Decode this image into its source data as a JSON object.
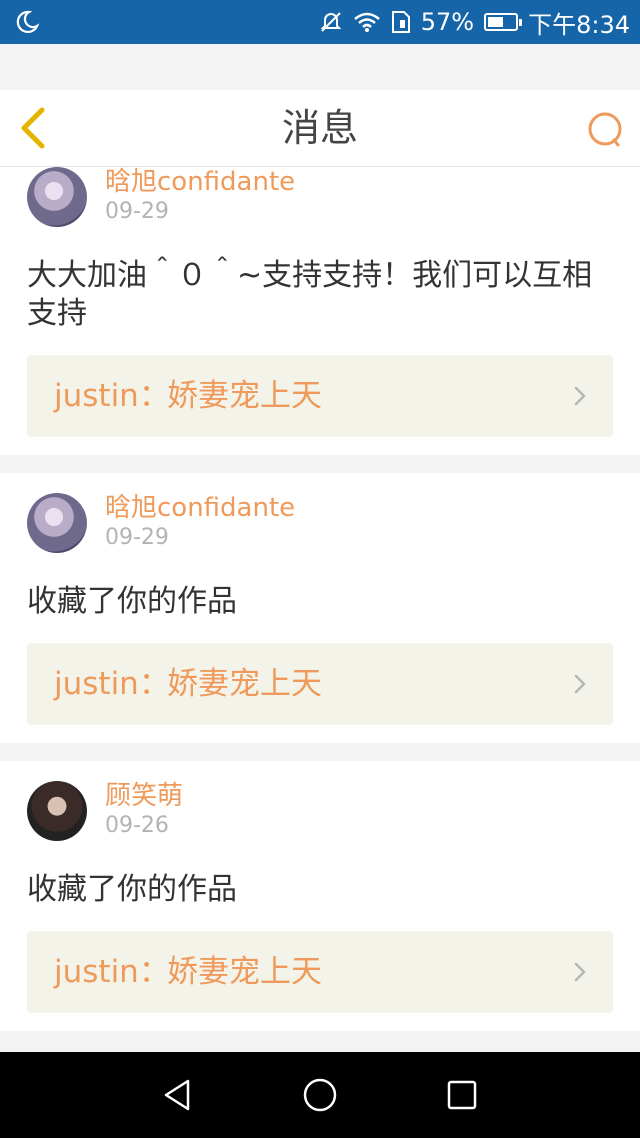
{
  "status_bar": {
    "battery_percent": "57%",
    "battery_level": 0.57,
    "time": "下午8:34",
    "icons": [
      "moon-icon",
      "mute-icon",
      "wifi-icon",
      "sim-icon",
      "battery-icon"
    ]
  },
  "header": {
    "title": "消息",
    "back_icon": "chevron-left-icon",
    "search_icon": "search-icon"
  },
  "messages": [
    {
      "username": "晗旭confidante",
      "date": "09-29",
      "text": "大大加油＾０＾~支持支持！我们可以互相支持",
      "work_author": "justin：",
      "work_title": "娇妻宠上天"
    },
    {
      "username": "晗旭confidante",
      "date": "09-29",
      "text": "收藏了你的作品",
      "work_author": "justin：",
      "work_title": "娇妻宠上天"
    },
    {
      "username": "顾笑萌",
      "date": "09-26",
      "text": "收藏了你的作品",
      "work_author": "justin：",
      "work_title": "娇妻宠上天"
    }
  ],
  "nav_bar": {
    "icons": [
      "back-triangle-icon",
      "home-circle-icon",
      "recents-square-icon"
    ]
  },
  "colors": {
    "status_bar": "#1565a8",
    "accent": "#ef9a5a",
    "back_icon": "#e6b400",
    "link_bg": "#f4f3ea"
  }
}
